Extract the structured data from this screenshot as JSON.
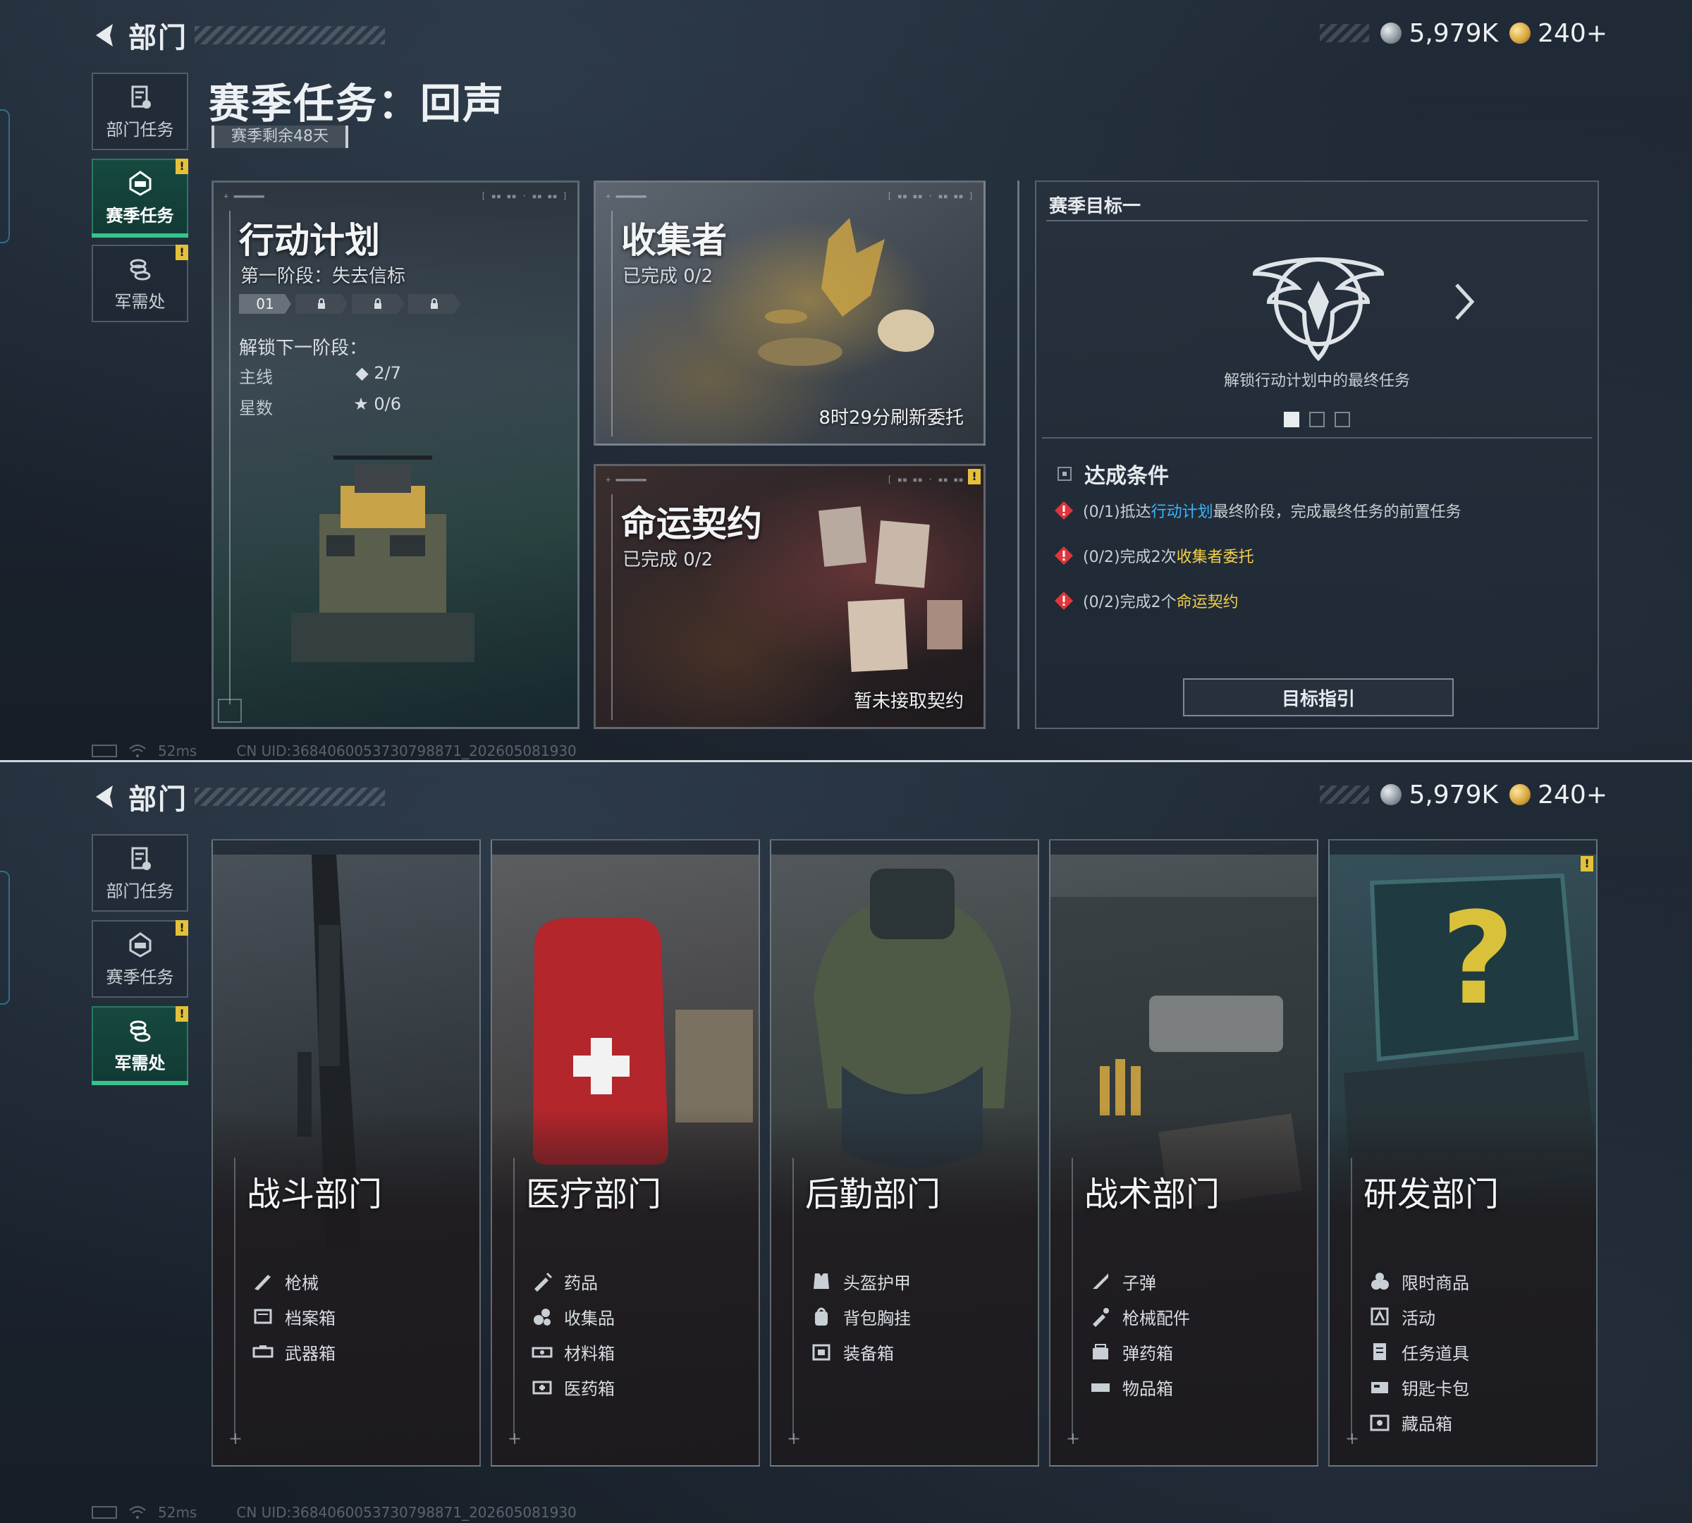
{
  "header": {
    "title": "部门"
  },
  "currency": {
    "silver": "5,979K",
    "gold": "240+"
  },
  "sidebar": {
    "items": [
      {
        "label": "部门任务",
        "icon": "document-icon",
        "badge": ""
      },
      {
        "label": "赛季任务",
        "icon": "season-icon",
        "badge": "!"
      },
      {
        "label": "军需处",
        "icon": "coins-icon",
        "badge": "!"
      }
    ]
  },
  "season": {
    "title": "赛季任务：回声",
    "remaining": "赛季剩余48天",
    "plan": {
      "title": "行动计划",
      "stage": "第一阶段：失去信标",
      "phase_first": "01",
      "unlock_title": "解锁下一阶段：",
      "main_label": "主线",
      "main_value": "◆ 2/7",
      "stars_label": "星数",
      "stars_value": "★ 0/6"
    },
    "collector": {
      "title": "收集者",
      "progress": "已完成 0/2",
      "refresh": "8时29分刷新委托"
    },
    "fate": {
      "title": "命运契约",
      "progress": "已完成 0/2",
      "status": "暂未接取契约",
      "badge": "!"
    },
    "goal": {
      "header": "赛季目标一",
      "desc": "解锁行动计划中的最终任务",
      "cond_title": "达成条件",
      "cond1_pre": "(0/1)抵达",
      "cond1_hl": "行动计划",
      "cond1_post": "最终阶段，完成最终任务的前置任务",
      "cond2_pre": "(0/2)完成2次",
      "cond2_hl": "收集者委托",
      "cond3_pre": "(0/2)完成2个",
      "cond3_hl": "命运契约",
      "guide_label": "目标指引"
    }
  },
  "footer": {
    "ping": "52ms",
    "uid": "CN UID:3684060053730798871_202605081930"
  },
  "departments": [
    {
      "name": "战斗部门",
      "items": [
        "枪械",
        "档案箱",
        "武器箱"
      ]
    },
    {
      "name": "医疗部门",
      "items": [
        "药品",
        "收集品",
        "材料箱",
        "医药箱"
      ]
    },
    {
      "name": "后勤部门",
      "items": [
        "头盔护甲",
        "背包胸挂",
        "装备箱"
      ]
    },
    {
      "name": "战术部门",
      "items": [
        "子弹",
        "枪械配件",
        "弹药箱",
        "物品箱"
      ]
    },
    {
      "name": "研发部门",
      "items": [
        "限时商品",
        "活动",
        "任务道具",
        "钥匙卡包",
        "藏品箱"
      ],
      "badge": "!"
    }
  ],
  "colors": {
    "active_green": "#35c48a",
    "highlight_blue": "#39b6ff",
    "highlight_gold": "#f2cf4a",
    "warning_red": "#e0353a",
    "badge_yellow": "#e3c13a"
  }
}
